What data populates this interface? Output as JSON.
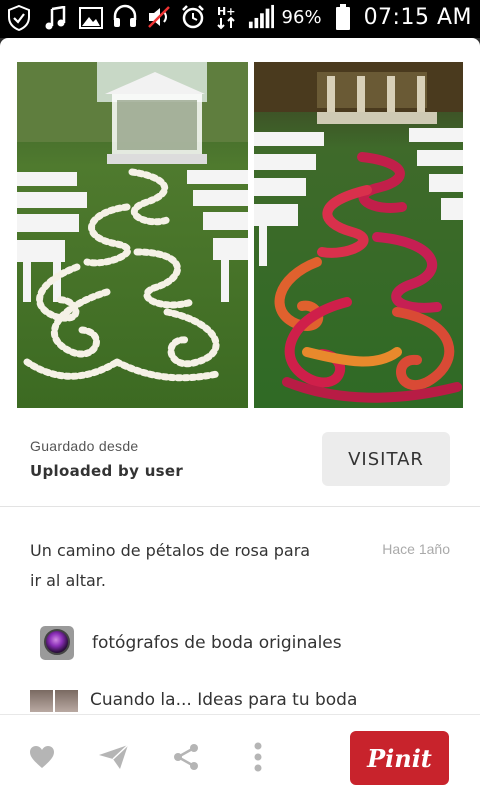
{
  "status_bar": {
    "battery_percent": "96%",
    "time": "07:15 AM",
    "icons": [
      "shield-icon",
      "music-icon",
      "image-icon",
      "headset-icon",
      "mute-icon",
      "alarm-icon",
      "hplus-icon",
      "signal-icon",
      "battery-icon"
    ]
  },
  "pin": {
    "saved_from_label": "Guardado desde",
    "saved_from_user": "Uploaded by user",
    "visit_label": "VISITAR",
    "description": "Un camino de pétalos de rosa para ir al altar.",
    "time_ago": "Hace 1año"
  },
  "boards": [
    {
      "name": "fotógrafos de boda originales",
      "icon": "camera-lens-icon"
    },
    {
      "name": "Cuando la... Ideas para tu boda",
      "icon": "photo-collage-icon"
    }
  ],
  "actions": {
    "like_icon": "heart-icon",
    "send_icon": "send-icon",
    "share_icon": "share-icon",
    "more_icon": "more-vertical-icon",
    "pin_label": "Pinit"
  },
  "colors": {
    "pin_red": "#c8232c",
    "status_bg": "#000000"
  }
}
